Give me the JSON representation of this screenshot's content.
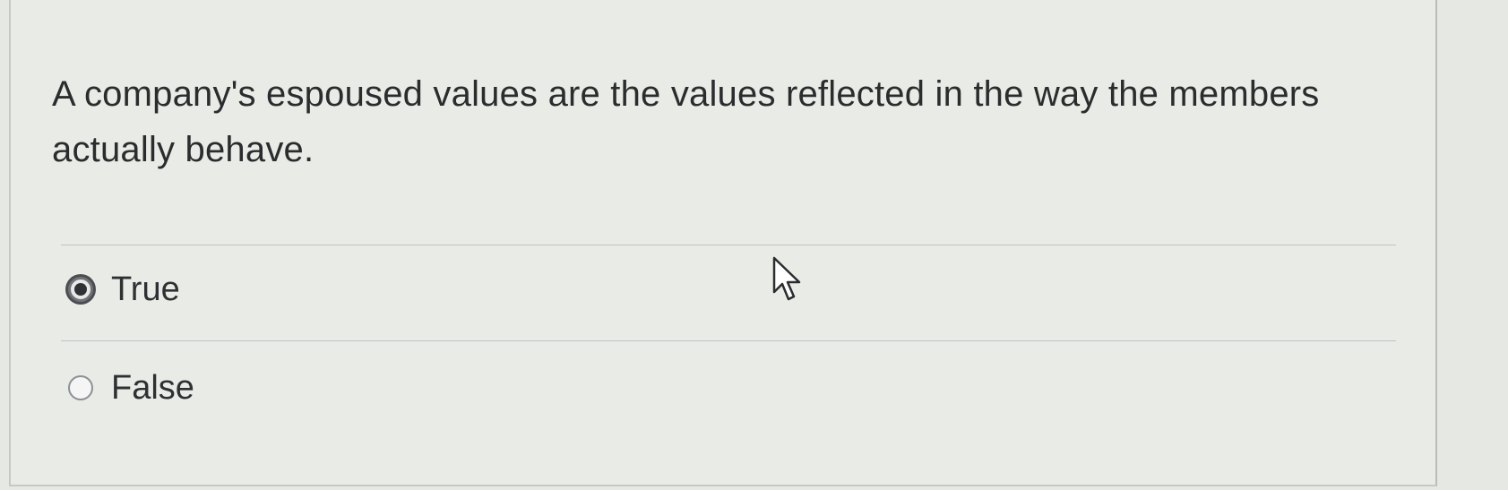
{
  "question": {
    "text": "A company's espoused values are the values reflected in the way the members actually behave."
  },
  "options": [
    {
      "label": "True",
      "selected": true
    },
    {
      "label": "False",
      "selected": false
    }
  ],
  "icons": {
    "cursor": "mouse-pointer-icon"
  }
}
